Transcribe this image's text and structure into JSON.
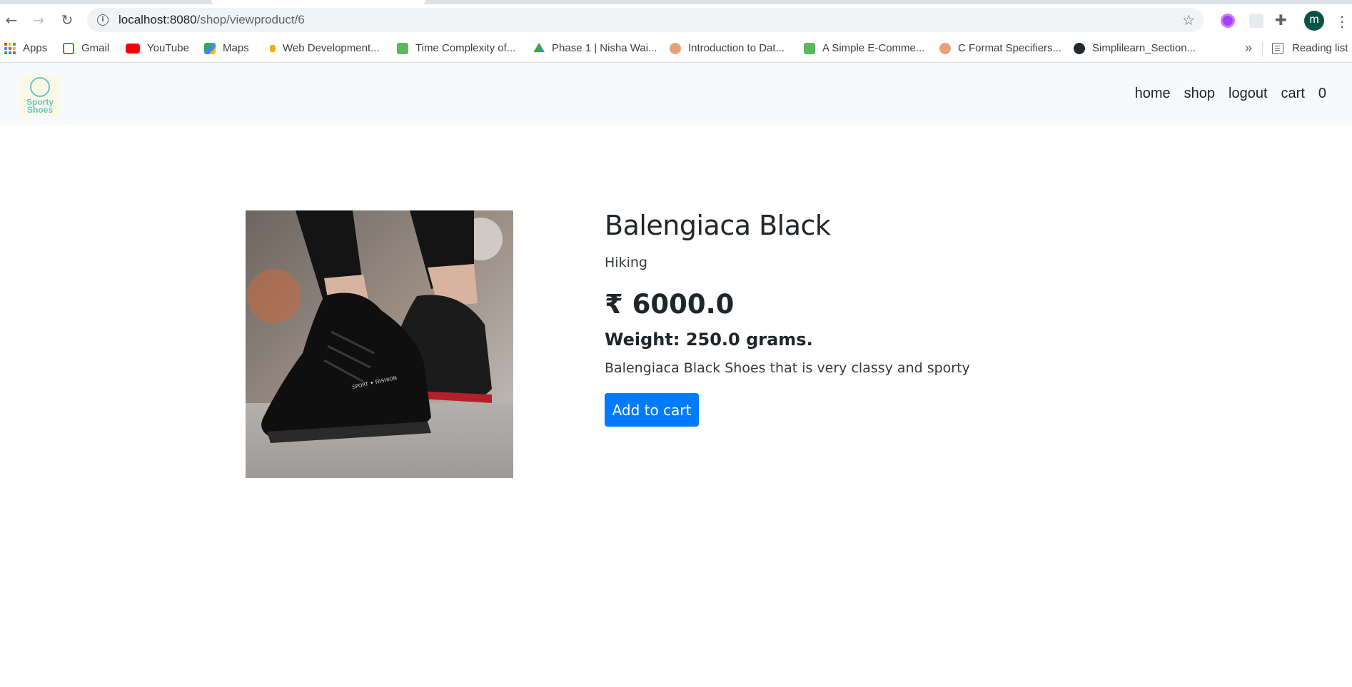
{
  "browser": {
    "url_host": "localhost:8080",
    "url_path": "/shop/viewproduct/6",
    "profile_initial": "m",
    "bookmarks": [
      {
        "label": "Apps",
        "icon": "apps-grid-icon"
      },
      {
        "label": "Gmail",
        "icon": "gmail-icon"
      },
      {
        "label": "YouTube",
        "icon": "youtube-icon"
      },
      {
        "label": "Maps",
        "icon": "maps-icon"
      },
      {
        "label": "Web Development...",
        "icon": "bookmark-favicon"
      },
      {
        "label": "Time Complexity of...",
        "icon": "leaf-icon"
      },
      {
        "label": "Phase 1 | Nisha Wai...",
        "icon": "google-drive-icon"
      },
      {
        "label": "Introduction to Dat...",
        "icon": "avatar-favicon"
      },
      {
        "label": "A Simple E-Comme...",
        "icon": "leaf-icon"
      },
      {
        "label": "C Format Specifiers...",
        "icon": "avatar-favicon"
      },
      {
        "label": "Simplilearn_Section...",
        "icon": "github-icon"
      }
    ],
    "more_label": "»",
    "reading_list_label": "Reading list"
  },
  "site": {
    "logo_line1": "Sporty",
    "logo_line2": "Shoes",
    "nav": {
      "home": "home",
      "shop": "shop",
      "logout": "logout",
      "cart": "cart",
      "cart_count": "0"
    }
  },
  "product": {
    "name": "Balengiaca Black",
    "category": "Hiking",
    "price": "₹ 6000.0",
    "weight": "Weight: 250.0 grams.",
    "description": "Balengiaca Black Shoes that is very classy and sporty",
    "add_to_cart_label": "Add to cart",
    "image_label": "SPORT ✦ FASHION"
  },
  "colors": {
    "primary": "#007bff",
    "navbar_bg": "#f8f9fa",
    "logo_accent": "#5fc9c6"
  }
}
